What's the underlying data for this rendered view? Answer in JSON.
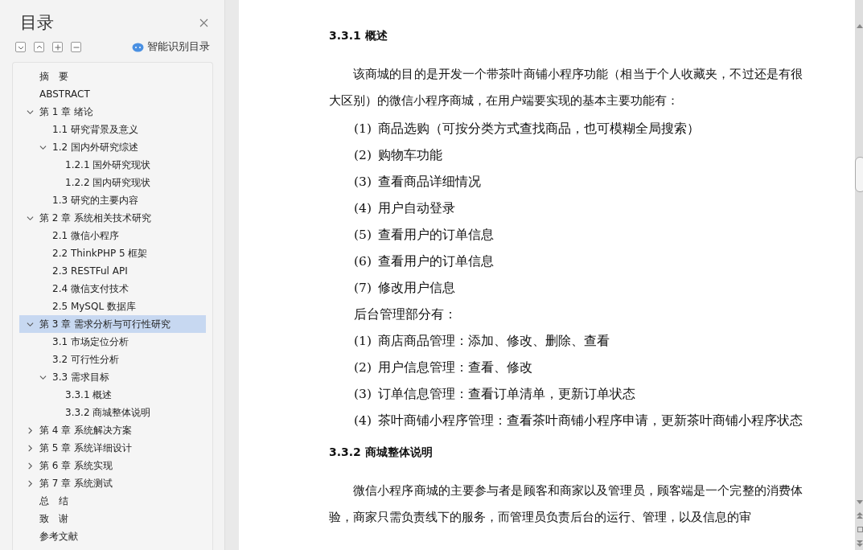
{
  "sidebar": {
    "title": "目录",
    "smart_toc": "智能识别目录",
    "tree": [
      {
        "label": "摘　要",
        "selected": false
      },
      {
        "label": "ABSTRACT",
        "selected": false
      },
      {
        "label": "第 1 章  绪论",
        "selected": false,
        "expanded": true,
        "children": [
          {
            "label": "1.1  研究背景及意义",
            "selected": false
          },
          {
            "label": "1.2  国内外研究综述",
            "selected": false,
            "expanded": true,
            "children": [
              {
                "label": "1.2.1 国外研究现状",
                "selected": false
              },
              {
                "label": "1.2.2 国内研究现状",
                "selected": false
              }
            ]
          },
          {
            "label": "1.3  研究的主要内容",
            "selected": false
          }
        ]
      },
      {
        "label": "第 2 章  系统相关技术研究",
        "selected": false,
        "expanded": true,
        "children": [
          {
            "label": "2.1  微信小程序",
            "selected": false
          },
          {
            "label": "2.2 ThinkPHP 5  框架",
            "selected": false
          },
          {
            "label": "2.3 RESTFul API",
            "selected": false
          },
          {
            "label": "2.4  微信支付技术",
            "selected": false
          },
          {
            "label": "2.5 MySQL 数据库",
            "selected": false
          }
        ]
      },
      {
        "label": "第 3 章  需求分析与可行性研究",
        "selected": true,
        "expanded": true,
        "children": [
          {
            "label": "3.1  市场定位分析",
            "selected": false
          },
          {
            "label": "3.2  可行性分析",
            "selected": false
          },
          {
            "label": "3.3  需求目标",
            "selected": false,
            "expanded": true,
            "children": [
              {
                "label": "3.3.1  概述",
                "selected": false
              },
              {
                "label": "3.3.2  商城整体说明",
                "selected": false
              }
            ]
          }
        ]
      },
      {
        "label": "第 4 章  系统解决方案",
        "selected": false,
        "expanded": false
      },
      {
        "label": "第 5 章  系统详细设计",
        "selected": false,
        "expanded": false
      },
      {
        "label": "第 6 章  系统实现",
        "selected": false,
        "expanded": false
      },
      {
        "label": "第 7 章  系统测试",
        "selected": false,
        "expanded": false
      },
      {
        "label": "总　结",
        "selected": false
      },
      {
        "label": "致　谢",
        "selected": false
      },
      {
        "label": "参考文献",
        "selected": false
      }
    ]
  },
  "document": [
    {
      "kind": "heading",
      "text": "3.3.1  概述"
    },
    {
      "kind": "paragraph",
      "text": "该商城的目的是开发一个带茶叶商铺小程序功能（相当于个人收藏夹，不过还是有很大区别）的微信小程序商城，在用户端要实现的基本主要功能有："
    },
    {
      "kind": "item",
      "number": "(1)",
      "text": "商品选购（可按分类方式查找商品，也可模糊全局搜索）"
    },
    {
      "kind": "item",
      "number": "(2)",
      "text": "购物车功能"
    },
    {
      "kind": "item",
      "number": "(3)",
      "text": "查看商品详细情况"
    },
    {
      "kind": "item",
      "number": "(4)",
      "text": "用户自动登录"
    },
    {
      "kind": "item",
      "number": "(5)",
      "text": "查看用户的订单信息"
    },
    {
      "kind": "item",
      "number": "(6)",
      "text": "查看用户的订单信息"
    },
    {
      "kind": "item",
      "number": "(7)",
      "text": "修改用户信息"
    },
    {
      "kind": "line",
      "text": "后台管理部分有："
    },
    {
      "kind": "item",
      "number": "(1)",
      "text": "商店商品管理：添加、修改、删除、查看"
    },
    {
      "kind": "item",
      "number": "(2)",
      "text": "用户信息管理：查看、修改"
    },
    {
      "kind": "item",
      "number": "(3)",
      "text": "订单信息管理：查看订单清单，更新订单状态"
    },
    {
      "kind": "item",
      "number": "(4)",
      "text": "茶叶商铺小程序管理：查看茶叶商铺小程序申请，更新茶叶商铺小程序状态"
    },
    {
      "kind": "heading",
      "text": "3.3.2  商城整体说明"
    },
    {
      "kind": "paragraph",
      "text": "微信小程序商城的主要参与者是顾客和商家以及管理员，顾客端是一个完整的消费体验，商家只需负责线下的服务，而管理员负责后台的运行、管理，以及信息的审"
    }
  ]
}
